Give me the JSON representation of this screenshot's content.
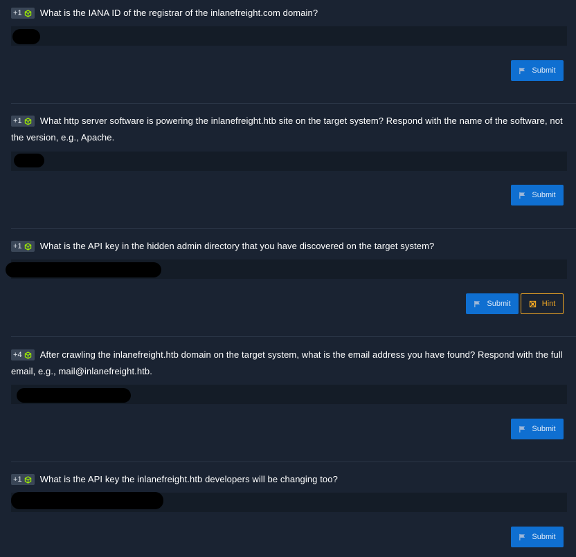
{
  "questions": [
    {
      "points": "+1",
      "text": "What is the IANA ID of the registrar of the inlanefreight.com domain?",
      "answer": "",
      "submit_label": "Submit"
    },
    {
      "points": "+1",
      "text": "What http server software is powering the inlanefreight.htb site on the target system? Respond with the name of the software, not the version, e.g., Apache.",
      "answer": "",
      "submit_label": "Submit"
    },
    {
      "points": "+1",
      "text": "What is the API key in the hidden admin directory that you have discovered on the target system?",
      "answer": "",
      "submit_label": "Submit",
      "hint_label": "Hint"
    },
    {
      "points": "+4",
      "text": "After crawling the inlanefreight.htb domain on the target system, what is the email address you have found? Respond with the full email, e.g., mail@inlanefreight.htb.",
      "answer": "",
      "submit_label": "Submit"
    },
    {
      "points": "+1",
      "text": "What is the API key the inlanefreight.htb developers will be changing too?",
      "answer": "",
      "submit_label": "Submit"
    }
  ],
  "icons": {
    "points": "cube-icon",
    "submit": "flag-icon",
    "hint": "hint-icon"
  },
  "colors": {
    "background": "#1a2332",
    "input": "#141c27",
    "submit": "#0f6fd1",
    "hint": "#f0a624",
    "cube": "#9fef00"
  }
}
